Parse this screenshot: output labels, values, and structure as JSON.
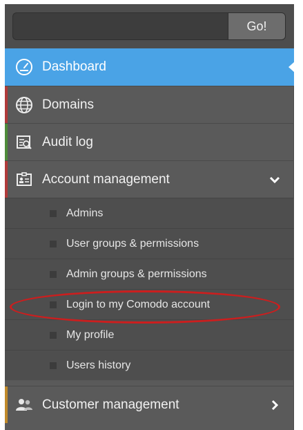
{
  "search": {
    "placeholder": "",
    "go_label": "Go!"
  },
  "nav": {
    "dashboard": "Dashboard",
    "domains": "Domains",
    "audit_log": "Audit log",
    "account_management": "Account management",
    "customer_management": "Customer management"
  },
  "submenu": [
    "Admins",
    "User groups & permissions",
    "Admin groups & permissions",
    "Login to my Comodo account",
    "My profile",
    "Users history"
  ],
  "colors": {
    "active": "#4aa3e6",
    "sidebar": "#5a5a5a",
    "highlight_oval": "#cc1e1e",
    "accent_domains": "#b03a3a",
    "accent_audit": "#4e8b3a",
    "accent_account": "#b03a3a",
    "accent_customer": "#c08a2a"
  },
  "icons": {
    "dashboard": "gauge-icon",
    "domains": "globe-icon",
    "audit_log": "audit-log-icon",
    "account_management": "id-card-icon",
    "customer_management": "users-icon",
    "expanded": "chevron-down-icon",
    "collapsed": "chevron-right-icon"
  }
}
